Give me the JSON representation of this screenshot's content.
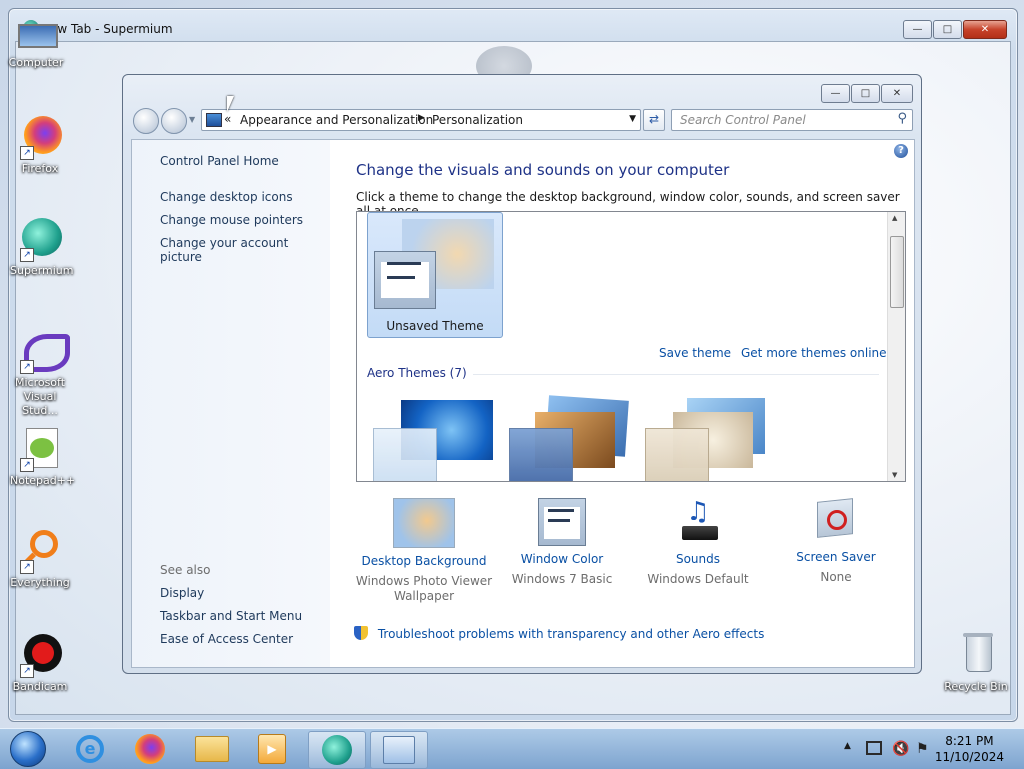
{
  "outer_window": {
    "title": "New Tab - Supermium"
  },
  "desktop_icons": [
    {
      "label": "Computer",
      "icon": "computer-icon"
    },
    {
      "label": "Firefox",
      "icon": "firefox-icon"
    },
    {
      "label": "Supermium",
      "icon": "supermium-icon"
    },
    {
      "label": "Microsoft Visual Stud...",
      "icon": "visual-studio-icon"
    },
    {
      "label": "Notepad++",
      "icon": "notepad-plus-plus-icon"
    },
    {
      "label": "Everything",
      "icon": "everything-search-icon"
    },
    {
      "label": "Bandicam",
      "icon": "bandicam-icon"
    },
    {
      "label": "Recycle Bin",
      "icon": "recycle-bin-icon"
    }
  ],
  "control_panel": {
    "breadcrumb": [
      "Appearance and Personalization",
      "Personalization"
    ],
    "breadcrumb_overflow": "«",
    "search_placeholder": "Search Control Panel",
    "nav": {
      "home": "Control Panel Home",
      "links": [
        "Change desktop icons",
        "Change mouse pointers",
        "Change your account picture"
      ],
      "see_also_label": "See also",
      "see_also": [
        "Display",
        "Taskbar and Start Menu",
        "Ease of Access Center"
      ]
    },
    "main": {
      "title": "Change the visuals and sounds on your computer",
      "subtitle": "Click a theme to change the desktop background, window color, sounds, and screen saver all at once.",
      "unsaved_theme": "Unsaved Theme",
      "save_theme": "Save theme",
      "get_more_themes": "Get more themes online",
      "aero_group": "Aero Themes (7)"
    },
    "bottom": [
      {
        "title": "Desktop Background",
        "value": "Windows Photo Viewer Wallpaper",
        "icon": "desktop-background-icon"
      },
      {
        "title": "Window Color",
        "value": "Windows 7 Basic",
        "icon": "window-color-icon"
      },
      {
        "title": "Sounds",
        "value": "Windows Default",
        "icon": "sounds-icon"
      },
      {
        "title": "Screen Saver",
        "value": "None",
        "icon": "screen-saver-icon"
      }
    ],
    "troubleshoot": "Troubleshoot problems with transparency and other Aero effects"
  },
  "taskbar": {
    "time": "8:21 PM",
    "date": "11/10/2024"
  }
}
